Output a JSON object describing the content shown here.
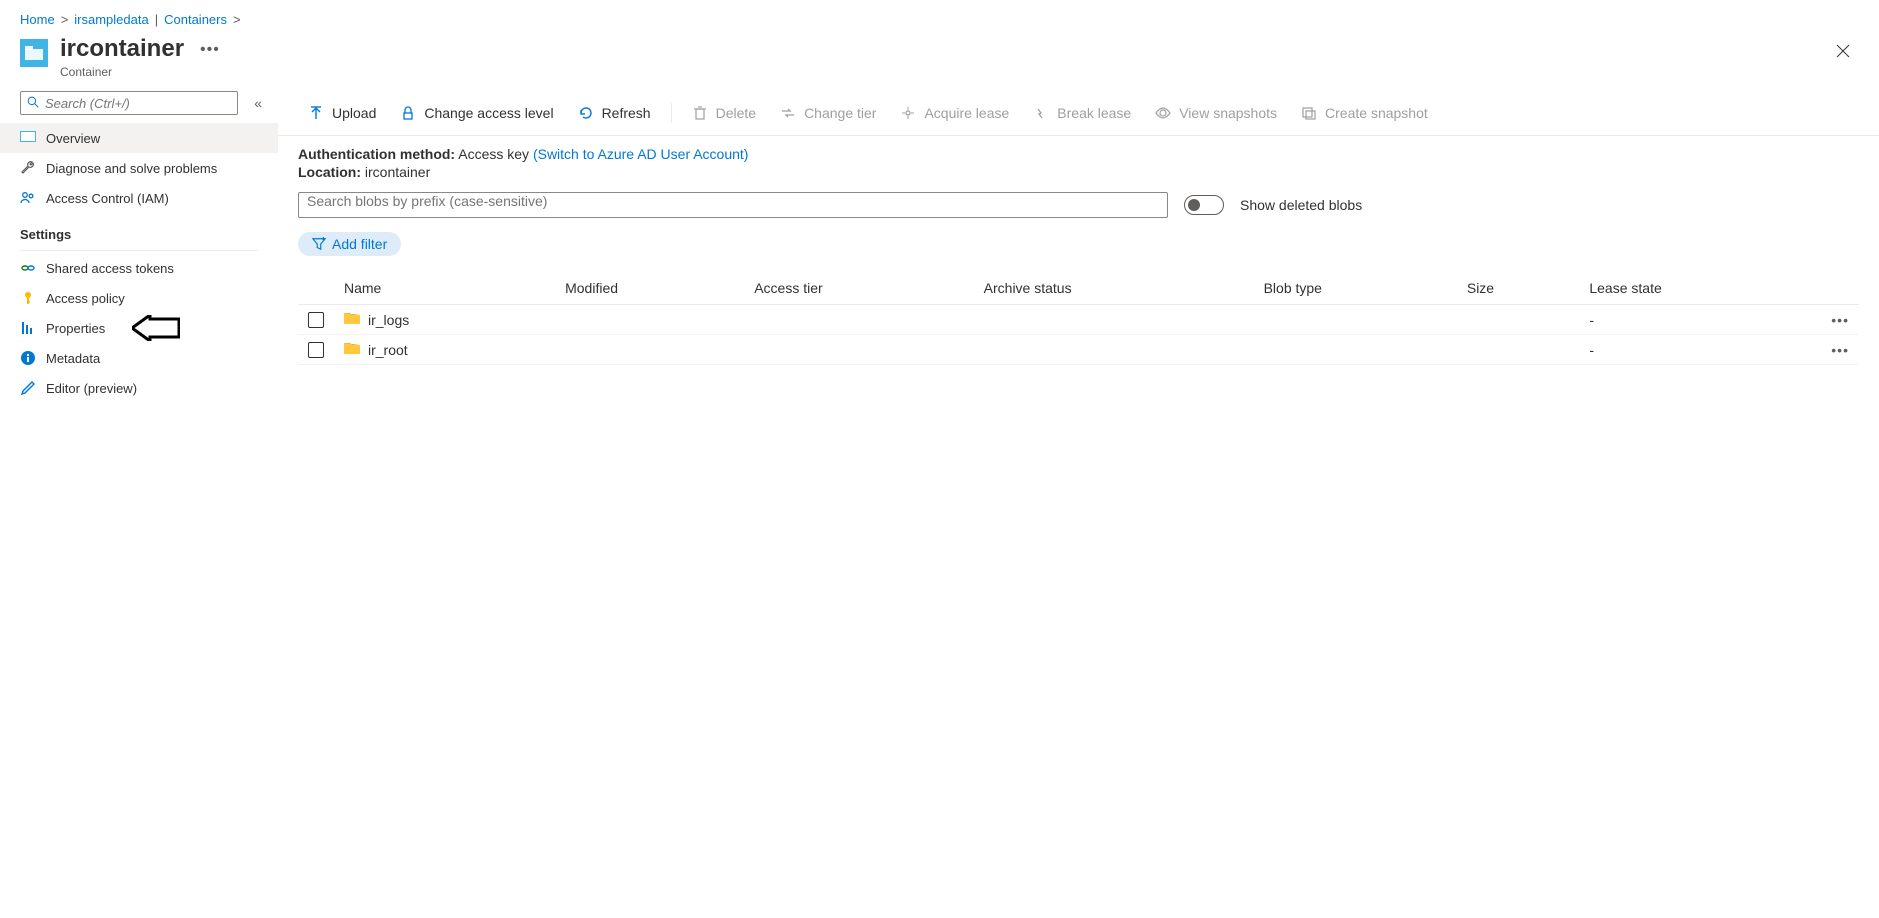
{
  "breadcrumb": {
    "home": "Home",
    "storage": "irsampledata",
    "divpipe": "|",
    "containers": "Containers"
  },
  "header": {
    "title": "ircontainer",
    "subtitle": "Container"
  },
  "sidebar": {
    "search_placeholder": "Search (Ctrl+/)",
    "overview": "Overview",
    "diagnose": "Diagnose and solve problems",
    "iam": "Access Control (IAM)",
    "settings_heading": "Settings",
    "sas": "Shared access tokens",
    "policy": "Access policy",
    "properties": "Properties",
    "metadata": "Metadata",
    "editor": "Editor (preview)"
  },
  "toolbar": {
    "upload": "Upload",
    "change_access": "Change access level",
    "refresh": "Refresh",
    "delete": "Delete",
    "change_tier": "Change tier",
    "acquire_lease": "Acquire lease",
    "break_lease": "Break lease",
    "view_snapshots": "View snapshots",
    "create_snapshot": "Create snapshot"
  },
  "info": {
    "auth_label": "Authentication method:",
    "auth_value": "Access key",
    "auth_switch": "(Switch to Azure AD User Account)",
    "location_label": "Location:",
    "location_value": "ircontainer"
  },
  "filter": {
    "search_placeholder": "Search blobs by prefix (case-sensitive)",
    "toggle_label": "Show deleted blobs",
    "add_filter": "Add filter"
  },
  "table": {
    "headers": {
      "name": "Name",
      "modified": "Modified",
      "access_tier": "Access tier",
      "archive_status": "Archive status",
      "blob_type": "Blob type",
      "size": "Size",
      "lease_state": "Lease state"
    },
    "rows": [
      {
        "name": "ir_logs",
        "lease_state": "-"
      },
      {
        "name": "ir_root",
        "lease_state": "-"
      }
    ]
  }
}
